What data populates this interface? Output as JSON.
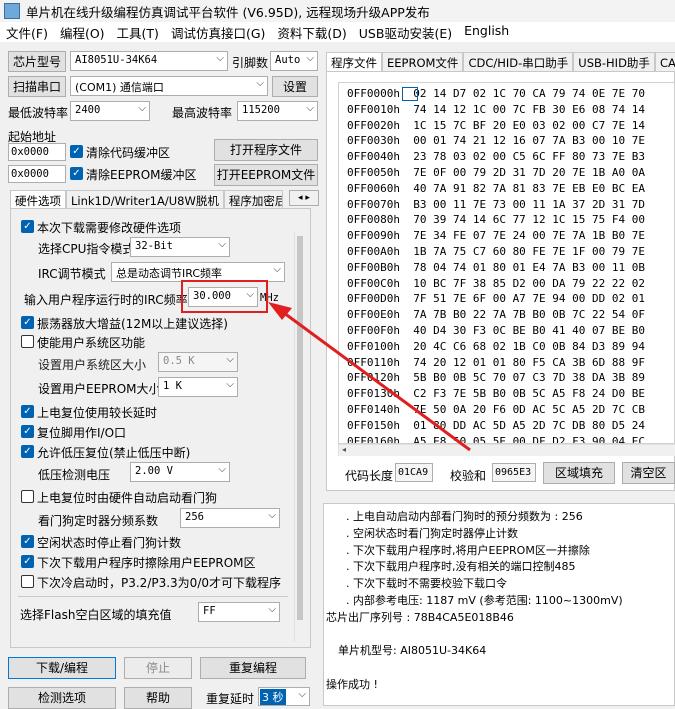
{
  "window": {
    "title": "单片机在线升级编程仿真调试平台软件 (V6.95D), 远程现场升级APP发布"
  },
  "menu": [
    "文件(F)",
    "编程(O)",
    "工具(T)",
    "调试仿真接口(G)",
    "资料下载(D)",
    "USB驱动安装(E)",
    "English"
  ],
  "chip": {
    "label": "芯片型号",
    "value": "AI8051U-34K64",
    "pin_label": "引脚数",
    "pin_value": "Auto"
  },
  "port": {
    "scan_label": "扫描串口",
    "value": "(COM1) 通信端口",
    "settings": "设置"
  },
  "baud": {
    "min_label": "最低波特率",
    "min_value": "2400",
    "max_label": "最高波特率",
    "max_value": "115200"
  },
  "start": {
    "label": "起始地址",
    "addr1": "0x0000",
    "clear_code": "清除代码缓冲区",
    "open_prog": "打开程序文件",
    "addr2": "0x0000",
    "clear_eeprom": "清除EEPROM缓冲区",
    "open_eeprom": "打开EEPROM文件"
  },
  "left_tabs": [
    "硬件选项",
    "Link1D/Writer1A/U8W脱机",
    "程序加密后"
  ],
  "options": {
    "need_modify": "本次下载需要修改硬件选项",
    "cpu_label": "选择CPU指令模式",
    "cpu_value": "32-Bit",
    "irc_label": "IRC调节模式",
    "irc_value": "总是动态调节IRC频率",
    "freq_label": "输入用户程序运行时的IRC频率",
    "freq_value": "30.000",
    "freq_unit": "MHz",
    "amp": "振荡器放大增益(12M以上建议选择)",
    "sysarea": "使能用户系统区功能",
    "sys_size_label": "设置用户系统区大小",
    "sys_size_value": "0.5 K",
    "eeprom_size_label": "设置用户EEPROM大小",
    "eeprom_size_value": "1   K",
    "reset_delay": "上电复位使用较长延时",
    "reset_io": "复位脚用作I/O口",
    "lvd": "允许低压复位(禁止低压中断)",
    "lvd_label": "低压检测电压",
    "lvd_value": "2.00 V",
    "wdt_auto": "上电复位时由硬件自动启动看门狗",
    "wdt_div_label": "看门狗定时器分频系数",
    "wdt_div_value": "256",
    "idle_wdt": "空闲状态时停止看门狗计数",
    "erase_eeprom": "下次下载用户程序时擦除用户EEPROM区",
    "cold_boot": "下次冷启动时，P3.2/P3.3为0/0才可下载程序",
    "fill_label": "选择Flash空白区域的填充值",
    "fill_value": "FF"
  },
  "actions": {
    "download": "下载/编程",
    "stop": "停止",
    "reprogram": "重复编程",
    "detect": "检测选项",
    "help": "帮助",
    "repeat_delay_label": "重复延时",
    "repeat_delay_value": "3 秒"
  },
  "right_tabs": [
    "程序文件",
    "EEPROM文件",
    "CDC/HID-串口助手",
    "USB-HID助手",
    "CAN助"
  ],
  "hex_rows": [
    "0FF0000h  02 14 D7 02 1C 70 CA 79 74 0E 7E 70",
    "0FF0010h  74 14 12 1C 00 7C FB 30 E6 08 74 14",
    "0FF0020h  1C 15 7C BF 20 E0 03 02 00 C7 7E 14",
    "0FF0030h  00 01 74 21 12 16 07 7A B3 00 10 7E",
    "0FF0040h  23 78 03 02 00 C5 6C FF 80 73 7E B3",
    "0FF0050h  7E 0F 00 79 2D 31 7D 20 7E 1B A0 0A",
    "0FF0060h  40 7A 91 82 7A 81 83 7E EB E0 BC EA",
    "0FF0070h  B3 00 11 7E 73 00 11 1A 37 2D 31 7D",
    "0FF0080h  70 39 74 14 6C 77 12 1C 15 75 F4 00",
    "0FF0090h  7E 34 FE 07 7E 24 00 7E 7A 1B B0 7E",
    "0FF00A0h  1B 7A 75 C7 60 80 FE 7E 1F 00 79 7E",
    "0FF00B0h  78 04 74 01 80 01 E4 7A B3 00 11 0B",
    "0FF00C0h  10 BC 7F 38 85 D2 00 DA 79 22 22 02",
    "0FF00D0h  7F 51 7E 6F 00 A7 7E 94 00 DD 02 01",
    "0FF00E0h  7A 7B B0 22 7A 7B B0 0B 7C 22 54 0F",
    "0FF00F0h  40 D4 30 F3 0C BE B0 41 40 07 BE B0",
    "0FF0100h  20 4C C6 68 02 1B C0 0B 84 D3 89 94",
    "0FF0110h  74 20 12 01 01 80 F5 CA 3B 6D 88 9F",
    "0FF0120h  5B B0 0B 5C 70 07 C3 7D 38 DA 3B 89",
    "0FF0130h  C2 F3 7E 5B B0 0B 5C A5 F8 24 D0 BE",
    "0FF0140h  7E 50 0A 20 F6 0D AC 5C A5 2D 7C CB",
    "0FF0150h  01 80 DD AC 5D A5 2D 7C DB 80 D5 24",
    "0FF0160h  A5 E8 50 05 5E 00 DF D2 F3 90 04 EC"
  ],
  "code_bar": {
    "length_label": "代码长度",
    "length_value": "01CA9",
    "checksum_label": "校验和",
    "checksum_value": "0965E3",
    "fill_btn": "区域填充",
    "clear_btn": "清空区"
  },
  "log": [
    ". 上电自动启动内部看门狗时的预分频数为 : 256",
    ". 空闲状态时看门狗定时器停止计数",
    ". 下次下载用户程序时,将用户EEPROM区一并擦除",
    ". 下次下载用户程序时,没有相关的端口控制485",
    ". 下次下载时不需要校验下载口令",
    ". 内部参考电压: 1187 mV (参考范围: 1100~1300mV)",
    "芯片出厂序列号 : 78B4CA5E018B46",
    "",
    "单片机型号: AI8051U-34K64",
    "",
    "操作成功 !"
  ],
  "colors": {
    "highlight": "#e02020",
    "checkbox": "#0063b1"
  }
}
